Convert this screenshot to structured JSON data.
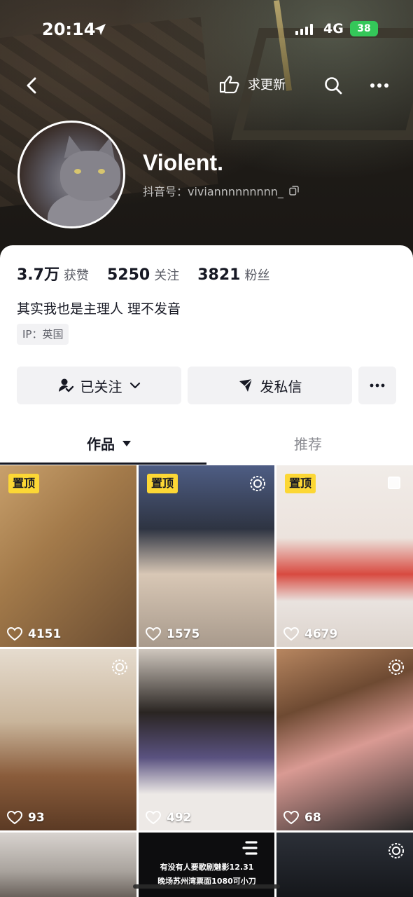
{
  "status_bar": {
    "time": "20:14",
    "network": "4G",
    "battery": "38"
  },
  "nav": {
    "request_update_label": "求更新"
  },
  "profile": {
    "nickname": "Violent.",
    "douyin_id_label": "抖音号：",
    "douyin_id": "viviannnnnnnnn_",
    "stats": [
      {
        "value": "3.7万",
        "label": "获赞"
      },
      {
        "value": "5250",
        "label": "关注"
      },
      {
        "value": "3821",
        "label": "粉丝"
      }
    ],
    "bio": "其实我也是主理人 理不发音",
    "ip": "IP：英国"
  },
  "actions": {
    "follow_label": "已关注",
    "message_label": "发私信"
  },
  "tabs": {
    "works": "作品",
    "recommend": "推荐"
  },
  "grid": {
    "pinned_label": "置顶",
    "tiles": [
      {
        "likes": "4151"
      },
      {
        "likes": "1575"
      },
      {
        "likes": "4679"
      },
      {
        "likes": "93"
      },
      {
        "likes": "492"
      },
      {
        "likes": "68"
      },
      {
        "likes": ""
      },
      {
        "likes": "",
        "caption": "有没有人要歌剧魅影12.31晚场苏州湾票面1080可小刀"
      },
      {
        "likes": ""
      }
    ]
  },
  "colors": {
    "pin_badge": "#fcd735",
    "battery": "#34c759",
    "text_primary": "#161823",
    "text_secondary": "#5c5e67",
    "button_bg": "#f2f2f4"
  },
  "icons": [
    "location-arrow-icon",
    "back-chevron-icon",
    "pointing-hand-icon",
    "search-icon",
    "more-dots-icon",
    "copy-icon",
    "user-check-icon",
    "chevron-down-icon",
    "send-icon",
    "heart-icon",
    "live-ring-icon",
    "triangle-down-icon"
  ]
}
